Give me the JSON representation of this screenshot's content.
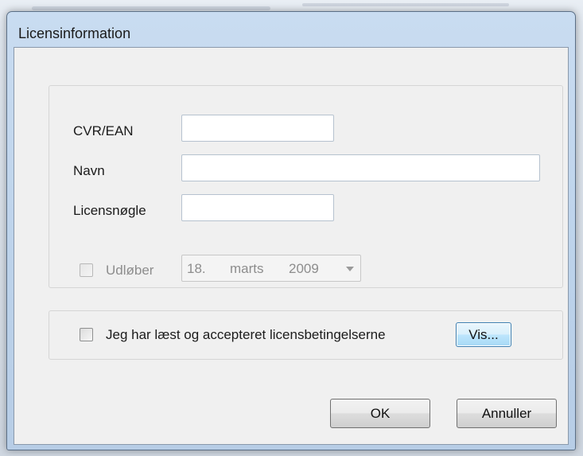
{
  "dialog": {
    "title": "Licensinformation"
  },
  "form": {
    "cvr_label": "CVR/EAN",
    "cvr_value": "",
    "navn_label": "Navn",
    "navn_value": "",
    "license_key_label": "Licensnøgle",
    "license_key_value": ""
  },
  "expiry": {
    "checkbox_label": "Udløber",
    "checked": false,
    "enabled": false,
    "date": {
      "day": "18.",
      "month": "marts",
      "year": "2009"
    }
  },
  "terms": {
    "checkbox_label": "Jeg har læst og accepteret licensbetingelserne",
    "checked": false,
    "view_button_label": "Vis..."
  },
  "buttons": {
    "ok_label": "OK",
    "cancel_label": "Annuller"
  }
}
